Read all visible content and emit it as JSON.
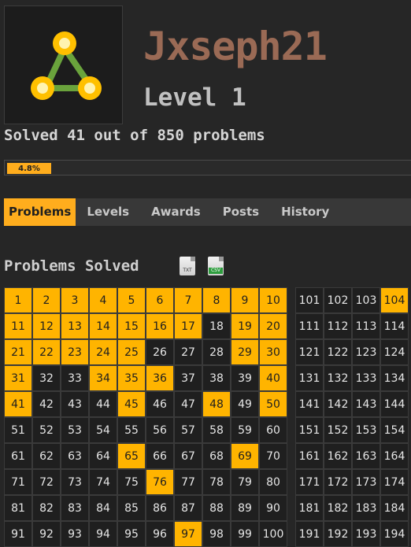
{
  "profile": {
    "username": "Jxseph21",
    "level_label": "Level 1",
    "solved_text": "Solved 41 out of 850 problems",
    "progress_label": "4.8%",
    "progress_fraction": 0.048
  },
  "tabs": [
    {
      "label": "Problems",
      "active": true
    },
    {
      "label": "Levels",
      "active": false
    },
    {
      "label": "Awards",
      "active": false
    },
    {
      "label": "Posts",
      "active": false
    },
    {
      "label": "History",
      "active": false
    }
  ],
  "section": {
    "title": "Problems Solved",
    "export_txt_label": "TXT",
    "export_csv_label": "CSV"
  },
  "grid_left": {
    "start": 1,
    "end": 100,
    "solved": [
      1,
      2,
      3,
      4,
      5,
      6,
      7,
      8,
      9,
      10,
      11,
      12,
      13,
      14,
      15,
      16,
      17,
      19,
      20,
      21,
      22,
      23,
      24,
      25,
      29,
      30,
      31,
      34,
      35,
      36,
      40,
      41,
      45,
      48,
      50,
      65,
      69,
      76,
      97
    ]
  },
  "grid_right": {
    "start": 101,
    "end": 194,
    "visible_cols": [
      1,
      2,
      3,
      4
    ],
    "solved": [
      104
    ]
  },
  "colors": {
    "accent": "#ffad1d",
    "solved": "#ffb400",
    "username": "#9a6a55",
    "background": "#262626",
    "logo_green": "#6aa33c",
    "logo_yellow": "#ffc000"
  },
  "icons": [
    "triangle-nodes-logo",
    "txt-file-icon",
    "csv-file-icon"
  ]
}
